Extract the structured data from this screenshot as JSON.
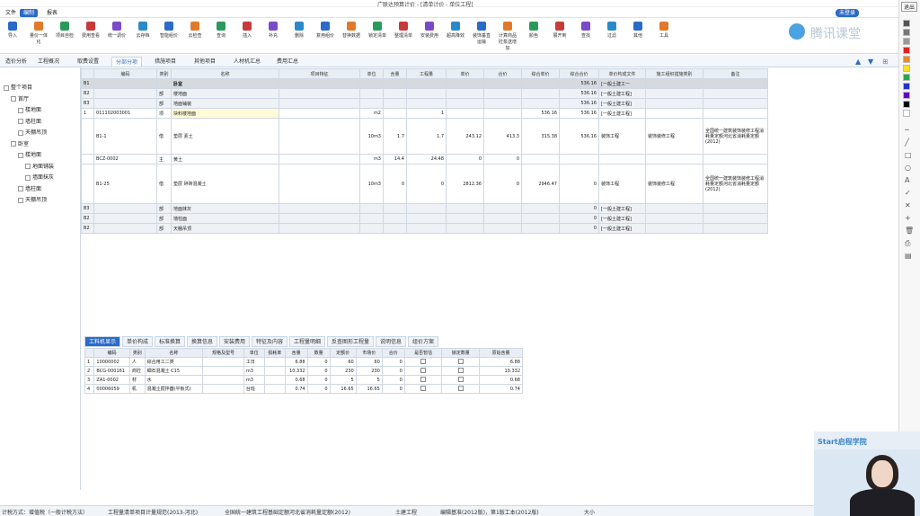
{
  "title": "广联达预算计价 - [清单计价 - 单位工程]",
  "menu": [
    "文件",
    "编制",
    "报表"
  ],
  "ribbon": [
    "导入",
    "量价一体化",
    "项目自检",
    "费用查看",
    "统一调价",
    "云存档",
    "智能组价",
    "云检查",
    "查询",
    "插入",
    "补充",
    "删除",
    "复用组价",
    "替换数据",
    "锁定清单",
    "整理清单",
    "安装费用",
    "超高降效",
    "装饰垂直运输",
    "计算商品砼泵送增加",
    "颜色",
    "展开到",
    "查找",
    "过滤",
    "其他",
    "工具"
  ],
  "tabs": [
    "造价分析",
    "工程概况",
    "取费设置",
    "分部分项",
    "措施项目",
    "其他项目",
    "人材机汇总",
    "费用汇总"
  ],
  "active_tab": "分部分项",
  "login_button": "未登录",
  "tree": [
    "整个项目",
    "首厅",
    "楼地面",
    "墙柱面",
    "天棚吊顶",
    "卧室",
    "楼地面",
    "地面铺装",
    "墙面抹灰",
    "墙柱面",
    "天棚吊顶"
  ],
  "grid": {
    "headers": [
      "",
      "编码",
      "类别",
      "名称",
      "项目特征",
      "单位",
      "含量",
      "工程量",
      "单价",
      "合价",
      "综合单价",
      "综合合价",
      "单价构成文件",
      "施工组织措施类别",
      "备注"
    ],
    "rows": [
      {
        "no": "B1",
        "code": "",
        "type": "",
        "name": "卧室",
        "feat": "",
        "unit": "",
        "qty": "",
        "amount": "",
        "price": "",
        "total": "",
        "cprice": "",
        "ctotal": "536.16",
        "file": "[一般土建工一",
        "org": "",
        "note": "",
        "cls": "grey"
      },
      {
        "no": "B2",
        "code": "",
        "type": "部",
        "name": "楼地面",
        "feat": "",
        "unit": "",
        "qty": "",
        "amount": "",
        "price": "",
        "total": "",
        "cprice": "",
        "ctotal": "536.16",
        "file": "[一般土建工程]",
        "org": "",
        "note": "",
        "cls": "light"
      },
      {
        "no": "B3",
        "code": "",
        "type": "部",
        "name": "地面铺装",
        "feat": "",
        "unit": "",
        "qty": "",
        "amount": "",
        "price": "",
        "total": "",
        "cprice": "",
        "ctotal": "536.16",
        "file": "[一般土建工程]",
        "org": "",
        "note": "",
        "cls": "light"
      },
      {
        "no": "1",
        "code": "011102003001",
        "type": "项",
        "name": "块料楼地面",
        "feat": "",
        "unit": "m2",
        "qty": "",
        "amount": "1",
        "price": "",
        "total": "",
        "cprice": "536.16",
        "ctotal": "536.16",
        "file": "[一般土建工程]",
        "org": "",
        "note": "",
        "cls": "sel"
      },
      {
        "no": "",
        "code": "B1-1",
        "type": "借",
        "name": "垫层 素土",
        "feat": "",
        "unit": "10m3",
        "qty": "1.7",
        "amount": "1.7",
        "price": "243.12",
        "total": "413.3",
        "cprice": "315.38",
        "ctotal": "536.16",
        "file": "装饰工程",
        "org": "装饰装修工程",
        "note": "全国统一建筑装饰装修工程消耗量定额河北省消耗量定额(2012)",
        "cls": "sel"
      },
      {
        "no": "",
        "code": "BCZ-0002",
        "type": "主",
        "name": "黄土",
        "feat": "",
        "unit": "m3",
        "qty": "14.4",
        "amount": "24.48",
        "price": "0",
        "total": "0",
        "cprice": "",
        "ctotal": "",
        "file": "",
        "org": "",
        "note": "",
        "cls": "sel"
      },
      {
        "no": "",
        "code": "B1-25",
        "type": "借",
        "name": "垫层 碎砖混凝土",
        "feat": "",
        "unit": "10m3",
        "qty": "0",
        "amount": "0",
        "price": "2812.36",
        "total": "0",
        "cprice": "2946.47",
        "ctotal": "0",
        "file": "装饰工程",
        "org": "装饰装修工程",
        "note": "全国统一建筑装饰装修工程消耗量定额河北省消耗量定额(2012)",
        "cls": "sel"
      },
      {
        "no": "B3",
        "code": "",
        "type": "部",
        "name": "地面抹灰",
        "feat": "",
        "unit": "",
        "qty": "",
        "amount": "",
        "price": "",
        "total": "",
        "cprice": "",
        "ctotal": "0",
        "file": "[一般土建工程]",
        "org": "",
        "note": "",
        "cls": "light"
      },
      {
        "no": "B2",
        "code": "",
        "type": "部",
        "name": "墙柱面",
        "feat": "",
        "unit": "",
        "qty": "",
        "amount": "",
        "price": "",
        "total": "",
        "cprice": "",
        "ctotal": "0",
        "file": "[一般土建工程]",
        "org": "",
        "note": "",
        "cls": "light"
      },
      {
        "no": "B2",
        "code": "",
        "type": "部",
        "name": "天棚吊顶",
        "feat": "",
        "unit": "",
        "qty": "",
        "amount": "",
        "price": "",
        "total": "",
        "cprice": "",
        "ctotal": "0",
        "file": "[一般土建工程]",
        "org": "",
        "note": "",
        "cls": "light"
      }
    ]
  },
  "lower_tabs": [
    "工料机显示",
    "单价构成",
    "标准换算",
    "换算信息",
    "安装费用",
    "特征及内容",
    "工程量明细",
    "反查图形工程量",
    "说明信息",
    "组价方案"
  ],
  "lower": {
    "headers": [
      "",
      "编码",
      "类别",
      "名称",
      "规格及型号",
      "单位",
      "损耗率",
      "含量",
      "数量",
      "定额价",
      "市场价",
      "合价",
      "是否暂估",
      "锁定数量",
      "原始含量"
    ],
    "rows": [
      [
        "1",
        "10000002",
        "人",
        "综合用工二类",
        "",
        "工日",
        "",
        "6.88",
        "0",
        "60",
        "60",
        "0",
        "",
        "",
        "6.88"
      ],
      [
        "2",
        "BCG-000161",
        "商砼",
        "细石混凝土 C15",
        "",
        "m3",
        "",
        "10.332",
        "0",
        "230",
        "230",
        "0",
        "",
        "",
        "10.332"
      ],
      [
        "3",
        "ZA1-0002",
        "材",
        "水",
        "",
        "m3",
        "",
        "0.68",
        "0",
        "5",
        "5",
        "0",
        "",
        "",
        "0.68"
      ],
      [
        "4",
        "00006059",
        "机",
        "混凝土搅拌器(平板式)",
        "",
        "台班",
        "",
        "0.74",
        "0",
        "16.65",
        "16.65",
        "0",
        "",
        "",
        "0.74"
      ]
    ]
  },
  "status": [
    "计税方式：增值税（一般计税方法）",
    "工程量清单项目计量规范(2013-河北)",
    "全国统一建筑工程基础定额河北省消耗量定额(2012)",
    "土建工程",
    "编辑基准(2012版)，第1版工本(2012版)",
    "大小"
  ],
  "side_label": "退出",
  "logo_text": "腾讯课堂",
  "video_banner": "Start启程学院",
  "colors": {
    "accent": "#2a6ac8",
    "grid_grey": "#d6d9de",
    "hilite": "#fffbd6"
  }
}
